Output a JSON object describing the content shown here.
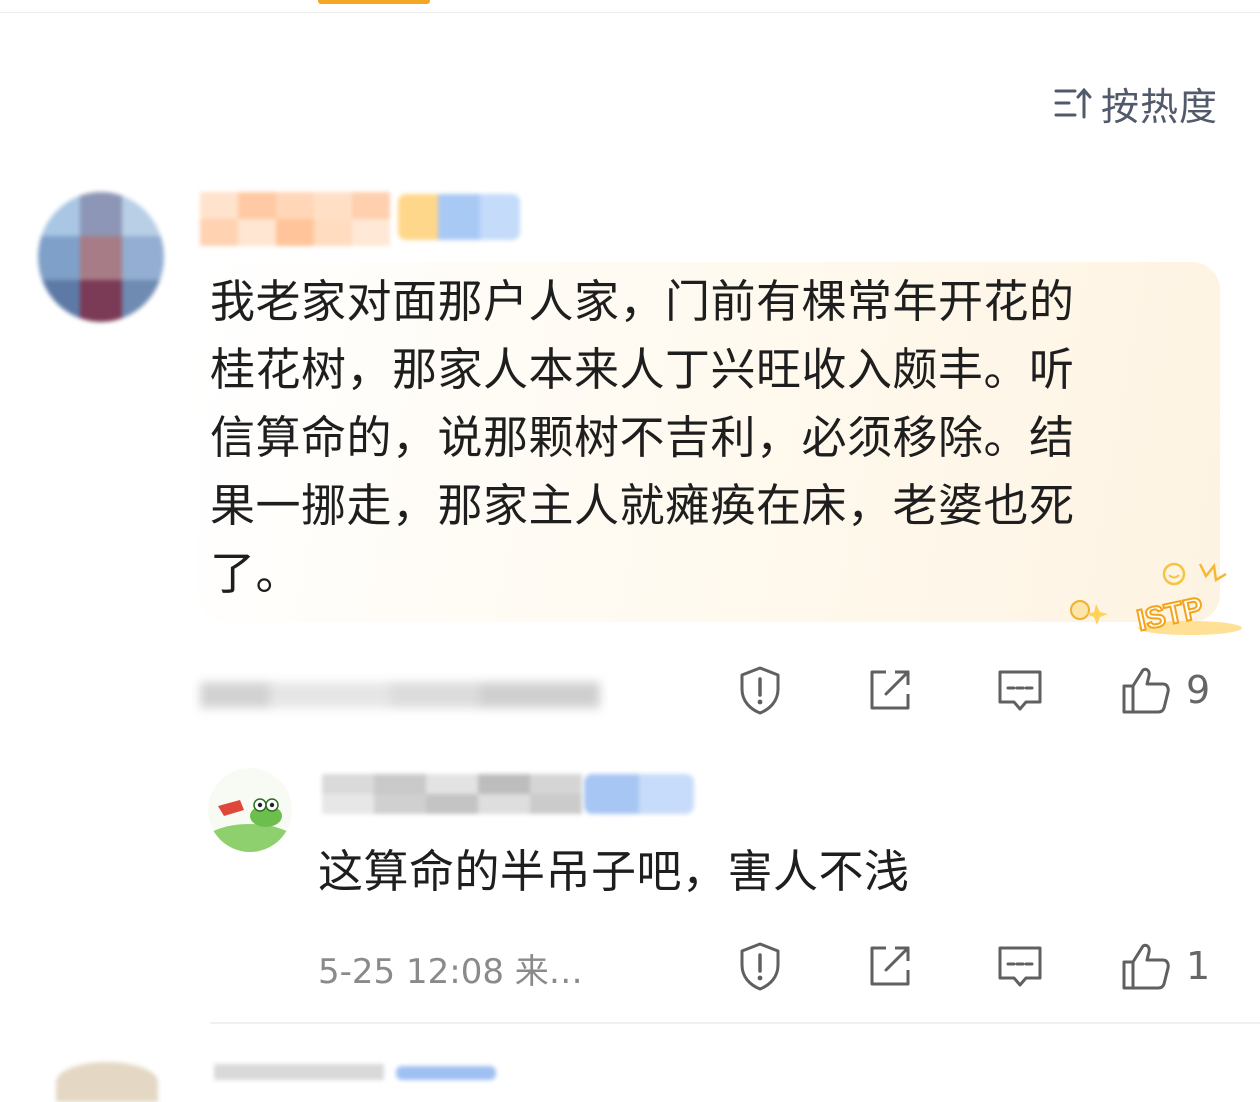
{
  "header": {
    "sort_label": "按热度",
    "sort_icon": "sort-icon"
  },
  "comment": {
    "lines": [
      "我老家对面那户人家，门前有棵常年开花的",
      "桂花树，那家人本来人丁兴旺收入颇丰。听",
      "信算命的，说那颗树不吉利，必须移除。结",
      "果一挪走，那家主人就瘫痪在床，老婆也死",
      "了。"
    ],
    "badge_text": "ISTP",
    "likes": "9"
  },
  "reply": {
    "text": "这算命的半吊子吧，害人不浅",
    "timestamp": "5-25 12:08 来…",
    "likes": "1"
  },
  "icons": {
    "report": "report-icon",
    "share": "share-icon",
    "comment": "comment-icon",
    "like": "like-icon"
  },
  "colors": {
    "accent": "#f5a623",
    "icon": "#606060",
    "card": "#fdf3e2"
  }
}
